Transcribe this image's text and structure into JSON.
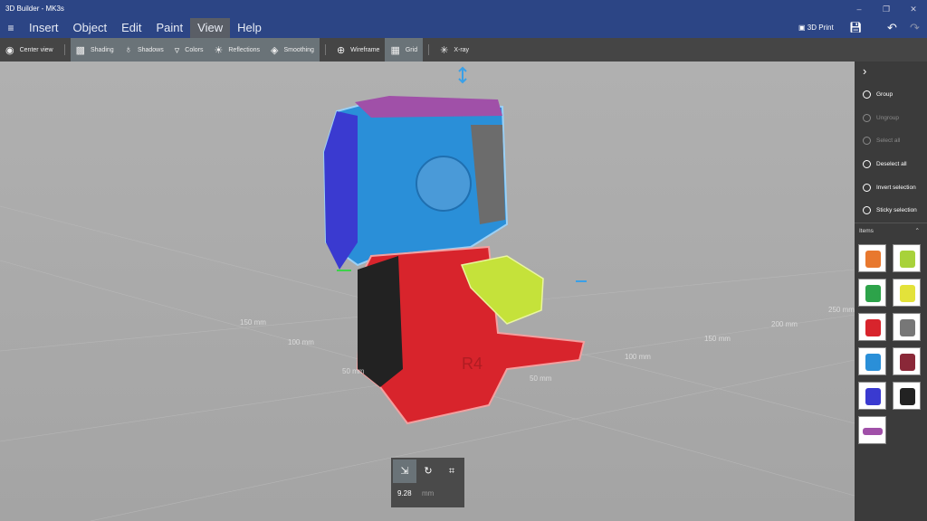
{
  "window": {
    "title": "3D Builder - MK3s",
    "minimize": "–",
    "maximize": "❐",
    "close": "✕"
  },
  "menu": {
    "items": [
      "Insert",
      "Object",
      "Edit",
      "Paint",
      "View",
      "Help"
    ],
    "active": "View"
  },
  "header": {
    "print_label": "3D Print"
  },
  "toolbar": {
    "center_view": "Center view",
    "shading": "Shading",
    "shadows": "Shadows",
    "colors": "Colors",
    "reflections": "Reflections",
    "smoothing": "Smoothing",
    "wireframe": "Wireframe",
    "grid": "Grid",
    "xray": "X-ray"
  },
  "panel": {
    "actions": [
      {
        "label": "Group",
        "enabled": true
      },
      {
        "label": "Ungroup",
        "enabled": false
      },
      {
        "label": "Select all",
        "enabled": false
      },
      {
        "label": "Deselect all",
        "enabled": true
      },
      {
        "label": "Invert selection",
        "enabled": true
      },
      {
        "label": "Sticky selection",
        "enabled": true
      }
    ],
    "items_label": "Items",
    "items": [
      {
        "color": "#e8782e"
      },
      {
        "color": "#a8d23a"
      },
      {
        "color": "#2da34a"
      },
      {
        "color": "#e3e23a"
      },
      {
        "color": "#d8242c"
      },
      {
        "color": "#777777"
      },
      {
        "color": "#2a8fd8"
      },
      {
        "color": "#8a2838"
      },
      {
        "color": "#3a3ad0"
      },
      {
        "color": "#222222"
      },
      {
        "color": "#a050a8"
      }
    ]
  },
  "grid_labels": [
    "150 mm",
    "100 mm",
    "50 mm",
    "50 mm",
    "100 mm",
    "150 mm",
    "200 mm",
    "250 mm"
  ],
  "minibar": {
    "value": "9.28",
    "unit": "mm"
  },
  "model_text": "R4"
}
